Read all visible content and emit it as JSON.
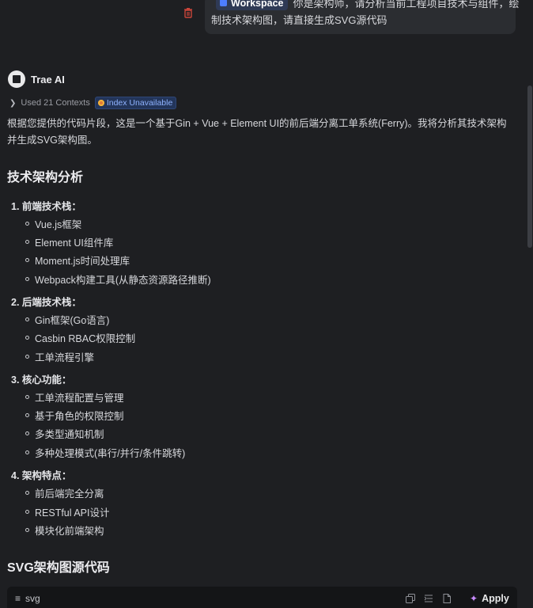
{
  "user_message": {
    "workspace_chip": "Workspace",
    "line1": "你是架构师，请分析当前工程项目技术与组件，绘",
    "line2": "制技术架构图，请直接生成SVG源代码"
  },
  "assistant": {
    "name": "Trae AI",
    "contexts_label": "Used 21 Contexts",
    "index_badge": "Index Unavailable",
    "intro": "根据您提供的代码片段，这是一个基于Gin + Vue + Element UI的前后端分离工单系统(Ferry)。我将分析其技术架构并生成SVG架构图。",
    "heading_analysis": "技术架构分析",
    "sections": [
      {
        "title": "1. 前端技术栈：",
        "items": [
          "Vue.js框架",
          "Element UI组件库",
          "Moment.js时间处理库",
          "Webpack构建工具(从静态资源路径推断)"
        ]
      },
      {
        "title": "2. 后端技术栈：",
        "items": [
          "Gin框架(Go语言)",
          "Casbin RBAC权限控制",
          "工单流程引擎"
        ]
      },
      {
        "title": "3. 核心功能：",
        "items": [
          "工单流程配置与管理",
          "基于角色的权限控制",
          "多类型通知机制",
          "多种处理模式(串行/并行/条件跳转)"
        ]
      },
      {
        "title": "4. 架构特点：",
        "items": [
          "前后端完全分离",
          "RESTful API设计",
          "模块化前端架构"
        ]
      }
    ],
    "heading_svg": "SVG架构图源代码",
    "code_block": {
      "language": "svg",
      "apply_label": "Apply"
    }
  },
  "colors": {
    "background": "#1e1f22",
    "bubble": "#2b2d31",
    "accent": "#4d7dff",
    "badge_text": "#8fb3ff",
    "trash": "#c9453a"
  },
  "icons": [
    "trash-icon",
    "workspace-icon",
    "trae-logo-icon",
    "chevron-right-icon",
    "index-status-icon",
    "code-lines-icon",
    "copy-icon",
    "insert-icon",
    "new-file-icon",
    "sparkle-icon"
  ]
}
